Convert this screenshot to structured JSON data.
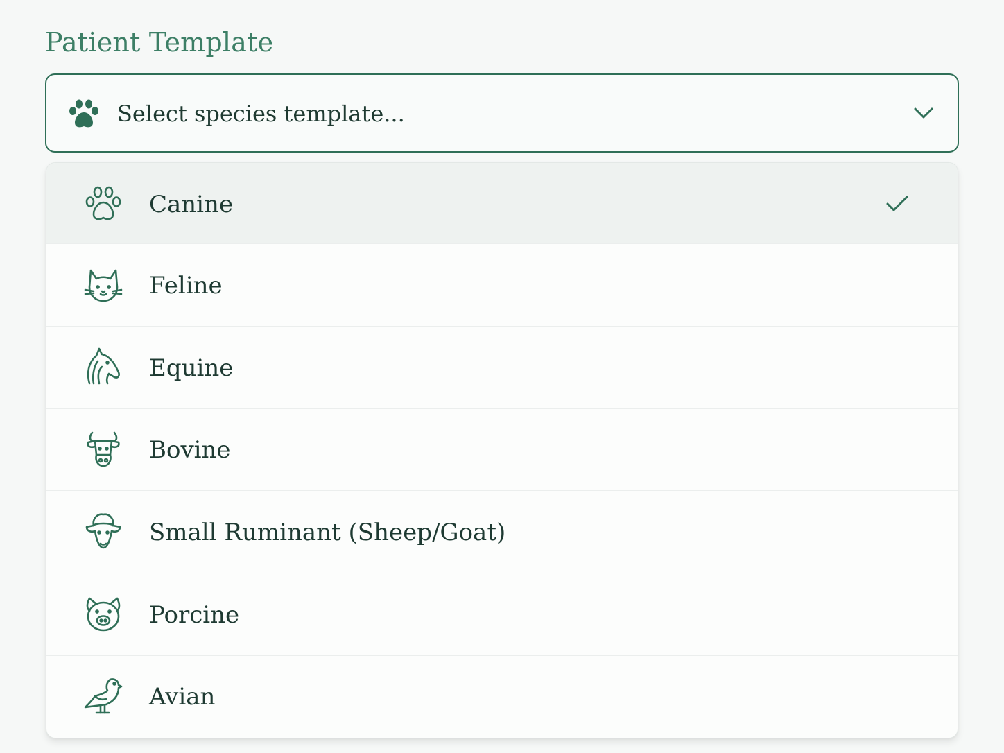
{
  "field": {
    "label": "Patient Template",
    "placeholder": "Select species template...",
    "leading_icon": "paw-icon",
    "trailing_icon": "chevron-down-icon"
  },
  "colors": {
    "accent": "#2f6f57",
    "label": "#3d7f66",
    "selected_row_bg": "#eef2f0"
  },
  "options": [
    {
      "label": "Canine",
      "icon": "paw-outline-icon",
      "selected": true
    },
    {
      "label": "Feline",
      "icon": "cat-icon",
      "selected": false
    },
    {
      "label": "Equine",
      "icon": "horse-icon",
      "selected": false
    },
    {
      "label": "Bovine",
      "icon": "cow-icon",
      "selected": false
    },
    {
      "label": "Small Ruminant (Sheep/Goat)",
      "icon": "sheep-icon",
      "selected": false
    },
    {
      "label": "Porcine",
      "icon": "pig-icon",
      "selected": false
    },
    {
      "label": "Avian",
      "icon": "bird-icon",
      "selected": false
    }
  ]
}
